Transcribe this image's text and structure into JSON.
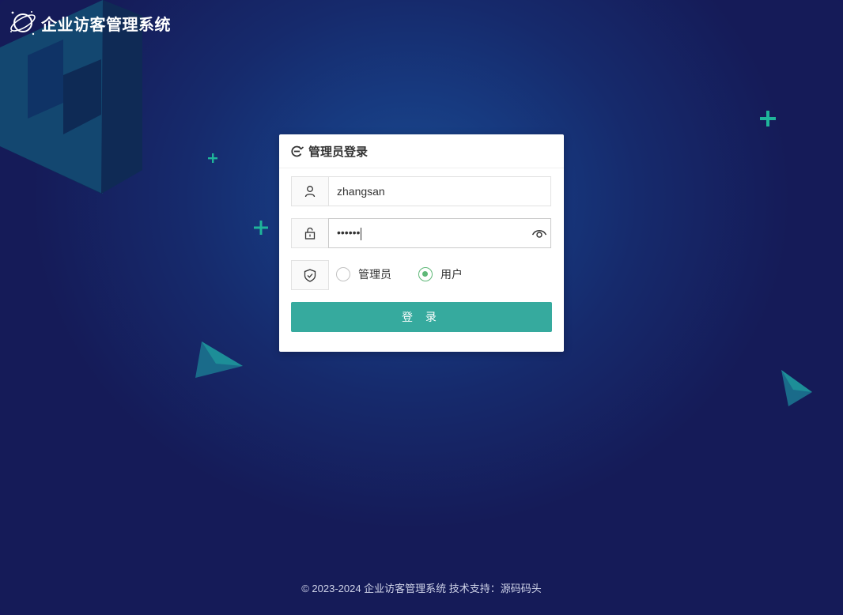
{
  "app": {
    "title": "企业访客管理系统"
  },
  "login": {
    "heading": "管理员登录",
    "username_value": "zhangsan",
    "password_masked": "••••••",
    "roles": [
      {
        "label": "管理员",
        "checked": false
      },
      {
        "label": "用户",
        "checked": true
      }
    ],
    "submit_label": "登 录"
  },
  "footer": {
    "text": "© 2023-2024 企业访客管理系统 技术支持：源码码头"
  },
  "colors": {
    "accent": "#36aa9e",
    "radio_checked": "#5fb878",
    "background": "#15195a",
    "plus_decoration": "#1fb59a"
  },
  "icons": [
    "planet-logo-icon",
    "user-icon",
    "lock-icon",
    "eye-icon",
    "shield-check-icon",
    "refresh-icon"
  ]
}
